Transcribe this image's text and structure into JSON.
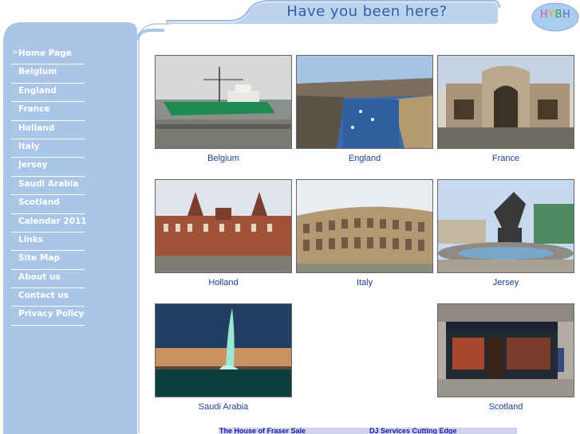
{
  "header": {
    "title": "Have you been here?"
  },
  "logo": {
    "text": "HYBH"
  },
  "nav": {
    "items": [
      {
        "label": "Home Page",
        "current": true
      },
      {
        "label": "Belgium"
      },
      {
        "label": "England"
      },
      {
        "label": "France"
      },
      {
        "label": "Holland"
      },
      {
        "label": "Italy"
      },
      {
        "label": "Jersey"
      },
      {
        "label": "Saudi Arabia"
      },
      {
        "label": "Scotland"
      },
      {
        "label": "Calendar 2011"
      },
      {
        "label": "Links"
      },
      {
        "label": "Site Map"
      },
      {
        "label": "About us"
      },
      {
        "label": "Contact us"
      },
      {
        "label": "Privacy Policy"
      }
    ]
  },
  "gallery": {
    "tiles": [
      {
        "caption": "Belgium"
      },
      {
        "caption": "England"
      },
      {
        "caption": "France"
      },
      {
        "caption": "Holland"
      },
      {
        "caption": "Italy"
      },
      {
        "caption": "Jersey"
      },
      {
        "caption": "Saudi Arabia"
      },
      {
        "caption": "Scotland"
      }
    ]
  },
  "footer": {
    "links": [
      "The House of Fraser Sale",
      "DJ Services Cutting Edge"
    ]
  },
  "colors": {
    "sidebar": "#a9c6e8",
    "header_tab": "#bcd3ee",
    "title_text": "#2f5fa6",
    "caption_text": "#1a3f95"
  }
}
